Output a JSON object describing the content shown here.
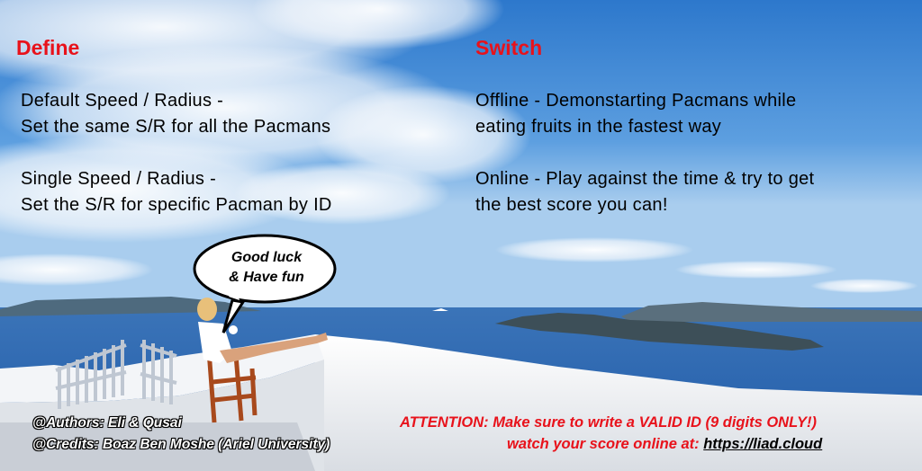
{
  "colors": {
    "heading": "#e8121b",
    "attention": "#e8121b"
  },
  "define": {
    "heading": "Define",
    "default_line1": "Default Speed / Radius -",
    "default_line2": "Set the same S/R for all the Pacmans",
    "single_line1": "Single Speed / Radius -",
    "single_line2": "Set the S/R for specific Pacman by ID"
  },
  "switch": {
    "heading": "Switch",
    "offline_line1": "Offline - Demonstarting Pacmans while",
    "offline_line2": "eating fruits in the fastest way",
    "online_line1": "Online - Play against the time & try to get",
    "online_line2": "the best score you can!"
  },
  "bubble": {
    "line1": "Good luck",
    "line2": "& Have fun"
  },
  "footer": {
    "authors": "@Authors: Eli & Qusai",
    "credits": "@Credits: Boaz Ben Moshe (Ariel University)",
    "attention": "ATTENTION: Make sure to write a VALID ID (9 digits ONLY!)",
    "watch_prefix": "watch your score online at: ",
    "watch_link": "https://liad.cloud"
  }
}
